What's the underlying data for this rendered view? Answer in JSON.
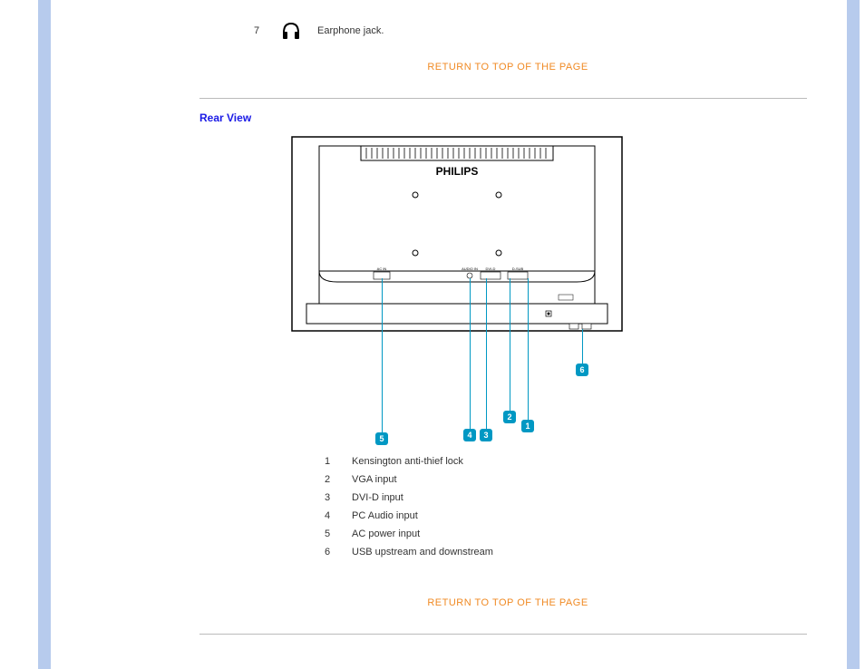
{
  "front_item": {
    "num": "7",
    "icon": "headphones-icon",
    "desc": "Earphone jack."
  },
  "return_link": "RETURN TO TOP OF THE PAGE",
  "rear_view_title": "Rear View",
  "brand": "PHILIPS",
  "port_labels": {
    "ac": "AC IN",
    "audio": "AUDIO IN",
    "dvi": "DVI-D",
    "vga": "D-SUB"
  },
  "callouts": [
    "1",
    "2",
    "3",
    "4",
    "5",
    "6"
  ],
  "rear_items": [
    {
      "n": "1",
      "desc": "Kensington anti-thief lock"
    },
    {
      "n": "2",
      "desc": "VGA input"
    },
    {
      "n": "3",
      "desc": "DVI-D input"
    },
    {
      "n": "4",
      "desc": "PC Audio input"
    },
    {
      "n": "5",
      "desc": "AC power input"
    },
    {
      "n": "6",
      "desc": "USB upstream and downstream"
    }
  ]
}
